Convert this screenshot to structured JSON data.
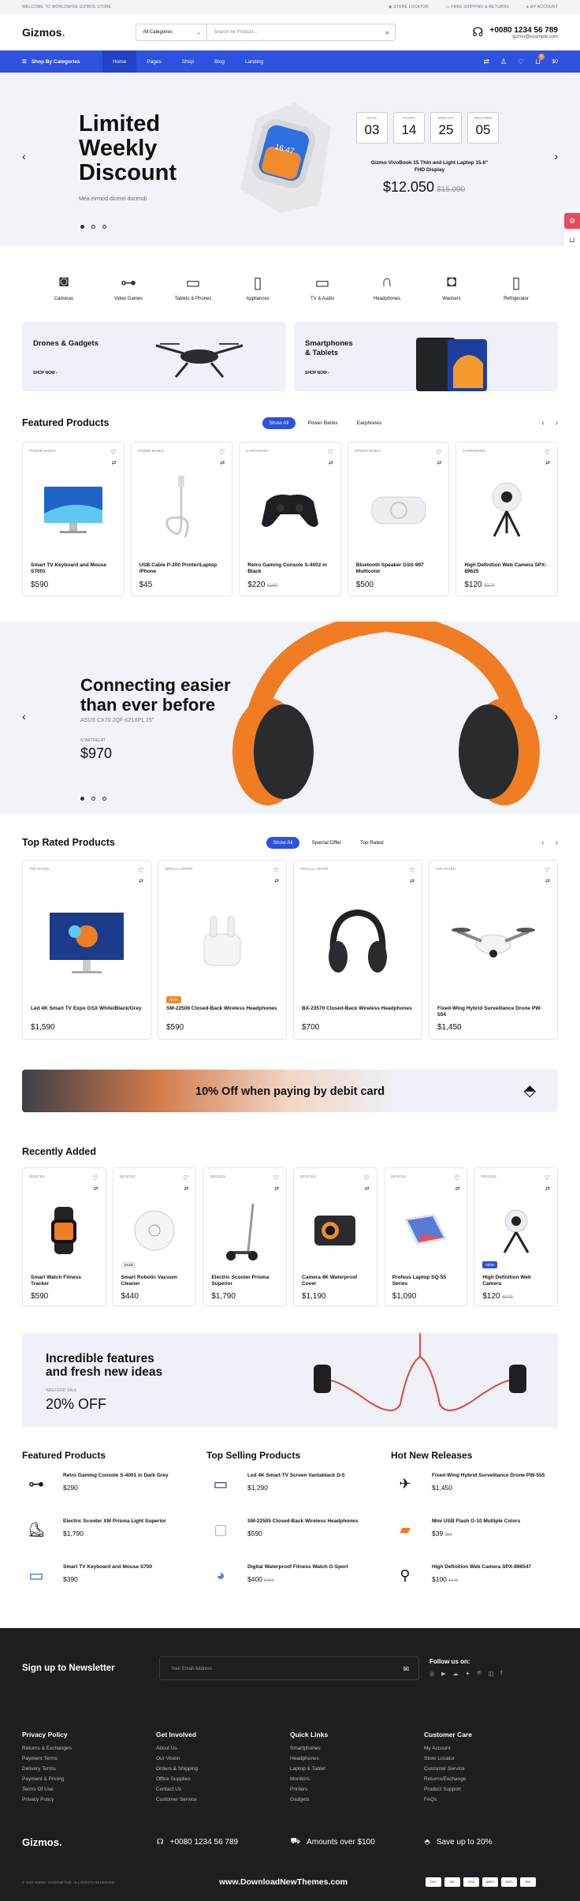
{
  "topbar": {
    "welcome": "WELCOME TO WORLDWIDE GIZMOS STORE",
    "store": "STORE LOCATOR",
    "shipping": "FREE SHIPPING & RETURNS",
    "account": "MY ACCOUNT"
  },
  "header": {
    "logo": "Gizmos",
    "logo_dot": ".",
    "category": "All Categories",
    "search_placeholder": "Search for Product...",
    "phone": "+0080 1234 56 789",
    "email": "gizmo@example.com"
  },
  "nav": {
    "shop_by": "Shop By Categories",
    "links": [
      "Home",
      "Pages",
      "Shop",
      "Blog",
      "Landing"
    ],
    "cart_count": "0",
    "cart_total": "$0"
  },
  "hero": {
    "title": "Limited Weekly Discount",
    "subtitle": "Mea eirmod dicerei docendi",
    "timer": [
      {
        "label": "DAYS",
        "value": "03"
      },
      {
        "label": "HOURS",
        "value": "14"
      },
      {
        "label": "MINUTES",
        "value": "25"
      },
      {
        "label": "SECONDS",
        "value": "05"
      }
    ],
    "product": "Gizmo VivoBook 15 Thin and Light Laptop 15.6\" FHD Display",
    "price": "$12.050",
    "old_price": "$15.000",
    "watch_time": "16:47"
  },
  "categories": [
    "Cameras",
    "Video Games",
    "Tablets & Phones",
    "Appliances",
    "TV & Audio",
    "Headphones",
    "Washers",
    "Refrigerator"
  ],
  "promos": [
    {
      "title": "Drones & Gadgets",
      "cta": "SHOP NOW"
    },
    {
      "title": "Smartphones & Tablets",
      "cta": "SHOP NOW"
    }
  ],
  "featured": {
    "title": "Featured Products",
    "tabs": [
      "Show All",
      "Power Banks",
      "Earphones"
    ],
    "items": [
      {
        "cat": "POWER BANKS",
        "name": "Smart TV Keyboard and Mouse S7001",
        "price": "$590",
        "old": ""
      },
      {
        "cat": "POWER BANKS",
        "name": "USB Cable P-200 Printer/Laptop /Phone",
        "price": "$45",
        "old": ""
      },
      {
        "cat": "EARPHONES",
        "name": "Retro Gaming Console S-4002 in Black",
        "price": "$220",
        "old": "$290"
      },
      {
        "cat": "POWER BANKS",
        "name": "Bluetooth Speaker GSS-997 Multicolor",
        "price": "$500",
        "old": ""
      },
      {
        "cat": "EARPHONES",
        "name": "High Definition Web Camera SPX-89625",
        "price": "$120",
        "old": "$170"
      }
    ]
  },
  "banner": {
    "title": "Connecting easier than ever before",
    "model": "ASUS CX70 2QF-621XPL 15\"",
    "starting": "STARTING AT",
    "price": "$970"
  },
  "top_rated": {
    "title": "Top Rated Products",
    "tabs": [
      "Show All",
      "Special Offer",
      "Top Rated"
    ],
    "items": [
      {
        "cat": "TOP RATED",
        "name": "Led 4K Smart TV Expo GSX White/Black/Grey",
        "price": "$1,590",
        "badge": ""
      },
      {
        "cat": "SPECIAL OFFER",
        "name": "SM-22508 Closed-Back Wireless Headphones",
        "price": "$590",
        "badge": "NEW"
      },
      {
        "cat": "SPECIAL OFFER",
        "name": "BX-23570 Closed-Back Wireless Headphones",
        "price": "$700",
        "badge": ""
      },
      {
        "cat": "TOP RATED",
        "name": "Fixed-Wing Hybrid Surveillance Drone PW-554",
        "price": "$1,450",
        "badge": ""
      }
    ]
  },
  "debit": {
    "text": "10% Off when paying by debit card"
  },
  "recent": {
    "title": "Recently Added",
    "items": [
      {
        "cat": "DEVICES",
        "name": "Smart Watch Fitness Tracker",
        "price": "$590",
        "old": "",
        "badge": ""
      },
      {
        "cat": "DEVICES",
        "name": "Smart Robotic Vacuum Cleaner",
        "price": "$440",
        "old": "",
        "badge": "SALE"
      },
      {
        "cat": "DEVICES",
        "name": "Electric Scooter Prisma Superior",
        "price": "$1,790",
        "old": "",
        "badge": ""
      },
      {
        "cat": "DEVICES",
        "name": "Camera 4K Waterproof Cover",
        "price": "$1,190",
        "old": "",
        "badge": ""
      },
      {
        "cat": "DEVICES",
        "name": "Profeus Laptop SQ-55 Series",
        "price": "$1,090",
        "old": "",
        "badge": ""
      },
      {
        "cat": "DEVICES",
        "name": "High Definition Web Camera",
        "price": "$120",
        "old": "$170",
        "badge": "NEW"
      }
    ]
  },
  "features": {
    "title": "Incredible features and fresh new ideas",
    "sub": "WEEKEND SALE",
    "price": "20% OFF"
  },
  "lists": [
    {
      "title": "Featured Products",
      "items": [
        {
          "name": "Retro Gaming Console S-4001 in Dark Grey",
          "price": "$290",
          "old": ""
        },
        {
          "name": "Electric Scooter XM Prisma Light Superior",
          "price": "$1,790",
          "old": ""
        },
        {
          "name": "Smart TV Keyboard and Mouse S700",
          "price": "$390",
          "old": ""
        }
      ]
    },
    {
      "title": "Top Selling Products",
      "items": [
        {
          "name": "Led 4K Smart TV Screen Vantablack D-5",
          "price": "$1,290",
          "old": ""
        },
        {
          "name": "SM-22505 Closed-Back Wireless Headphones",
          "price": "$590",
          "old": ""
        },
        {
          "name": "Digital Waterproof Fitness Watch G-Sport",
          "price": "$400",
          "old": "$450"
        }
      ]
    },
    {
      "title": "Hot New Releases",
      "items": [
        {
          "name": "Fixed-Wing Hybrid Surveillance Drone PW-555",
          "price": "$1,450",
          "old": ""
        },
        {
          "name": "Mini USB Flash G-10 Multiple Colors",
          "price": "$39",
          "old": "$50"
        },
        {
          "name": "High Definition Web Camera SPX-896547",
          "price": "$100",
          "old": "$140"
        }
      ]
    }
  ],
  "footer": {
    "newsletter": "Sign up to Newsletter",
    "email_placeholder": "Your Email Address",
    "follow": "Follow us on:",
    "cols": [
      {
        "title": "Privacy Policy",
        "links": [
          "Returns & Exchanges",
          "Payment Terms",
          "Delivery Terms",
          "Payment & Pricing",
          "Terms Of Use",
          "Privacy Policy"
        ]
      },
      {
        "title": "Get Involved",
        "links": [
          "About Us",
          "Our Vision",
          "Orders & Shipping",
          "Office Supplies",
          "Contact Us",
          "Customer Service"
        ]
      },
      {
        "title": "Quick Links",
        "links": [
          "Smartphones",
          "Headphones",
          "Laptop & Tablet",
          "Monitors",
          "Printers",
          "Gadgets"
        ]
      },
      {
        "title": "Customer Care",
        "links": [
          "My Account",
          "Store Locator",
          "Customer Service",
          "Returns/Exchange",
          "Product Support",
          "FAQs"
        ]
      }
    ],
    "phone": "+0080 1234 56 789",
    "shipping": "Amounts over $100",
    "save": "Save up to 20%",
    "copyright": "© 2022 GIZMO. INTERNETIVE. ALL RIGHTS RESERVED.",
    "watermark": "www.DownloadNewThemes.com",
    "payments": [
      "PAY",
      "MC",
      "VISA",
      "AMEX",
      "DISC",
      "PAY"
    ]
  }
}
